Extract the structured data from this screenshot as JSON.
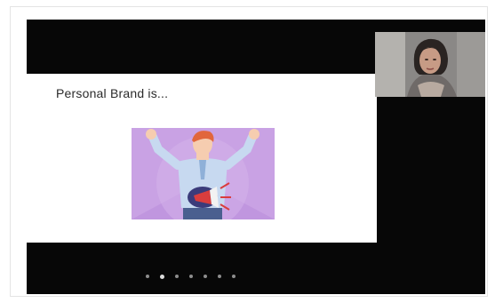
{
  "slide": {
    "title": "Personal Brand is...",
    "image_icon": "person-with-megaphone-icon"
  },
  "speaker_video": {
    "icon": "speaker-webcam-icon"
  },
  "pagination": {
    "total": 7,
    "active_index": 1
  },
  "colors": {
    "stage_background": "#070707",
    "slide_background": "#ffffff",
    "illustration_bg": "#c9a2e4",
    "shirt": "#c7d9f0",
    "megaphone": "#d93d3d"
  }
}
